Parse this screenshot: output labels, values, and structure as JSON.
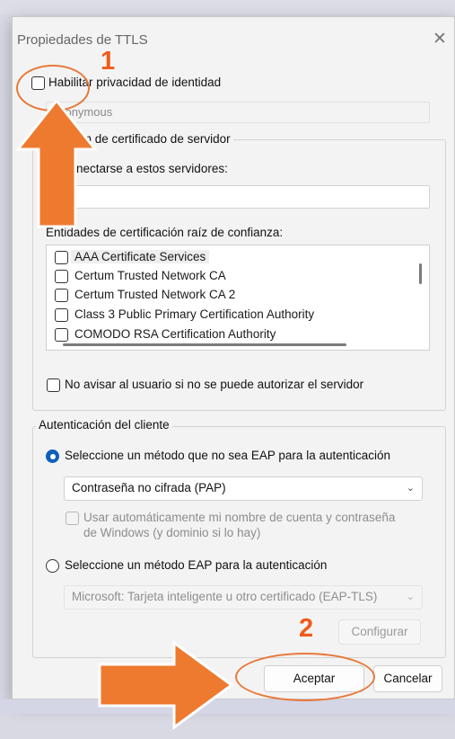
{
  "window": {
    "title": "Propiedades de TTLS",
    "close_glyph": "✕"
  },
  "identity": {
    "checkbox_label": "Habilitar privacidad de identidad",
    "value": "anonymous"
  },
  "server_cert": {
    "group_label": "ión de certificado de servidor",
    "connect_label": "nectarse a estos servidores:",
    "servers_value": "",
    "trusted_ca_label": "Entidades de certificación raíz de confianza:",
    "ca_items": [
      "AAA Certificate Services",
      "Certum Trusted Network CA",
      "Certum Trusted Network CA 2",
      "Class 3 Public Primary Certification Authority",
      "COMODO RSA Certification Authority"
    ],
    "no_warn_label": "No avisar al usuario si no se puede autorizar el servidor"
  },
  "client_auth": {
    "group_label": "Autenticación del cliente",
    "non_eap_label": "Seleccione un método que no sea EAP para la autenticación",
    "non_eap_selected": "Contraseña no cifrada (PAP)",
    "auto_credentials_line1": "Usar automáticamente mi nombre de cuenta y contraseña",
    "auto_credentials_line2": "de Windows (y dominio si lo hay)",
    "eap_label": "Seleccione un método EAP para la autenticación",
    "eap_selected": "Microsoft: Tarjeta inteligente u otro certificado (EAP-TLS)",
    "configure_label": "Configurar"
  },
  "buttons": {
    "ok": "Aceptar",
    "cancel": "Cancelar"
  },
  "annotations": {
    "step1": "1",
    "step2": "2"
  },
  "colors": {
    "accent_radio": "#0f5fbb",
    "annotation_orange": "#f05a1a"
  },
  "icons": {
    "chevron": "chevron-down-icon",
    "close": "close-icon",
    "arrow": "arrow-icon"
  }
}
